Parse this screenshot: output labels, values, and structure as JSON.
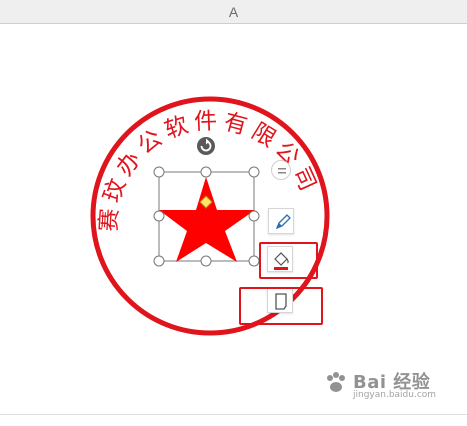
{
  "column_header": {
    "label": "A"
  },
  "seal": {
    "text": "赛玟办公软件有限公司",
    "color": "#e0141c"
  },
  "selection": {
    "handle_icon": "rotate-icon"
  },
  "floating_toolbar": {
    "layout_options_icon": "layout-options-icon",
    "style_icon": "pen-icon",
    "fill_icon": "fill-bucket-icon",
    "outline_icon": "shape-outline-icon"
  },
  "highlight_color": "#e0141c",
  "watermark": {
    "brand": "Bai 经验",
    "url": "jingyan.baidu.com"
  }
}
